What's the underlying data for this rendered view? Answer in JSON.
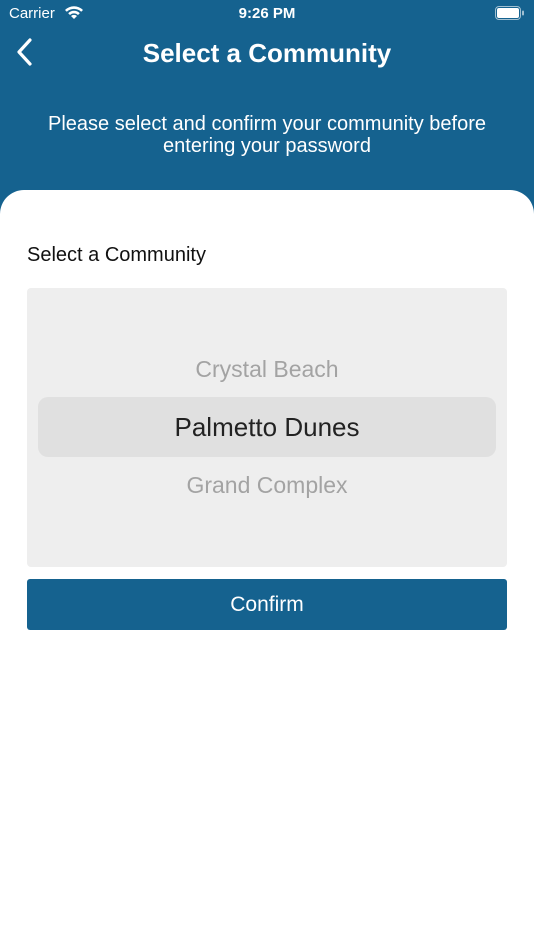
{
  "status_bar": {
    "carrier": "Carrier",
    "time": "9:26 PM",
    "icons": [
      "wifi-icon",
      "battery-icon"
    ]
  },
  "header": {
    "back_icon": "chevron-left-icon",
    "title": "Select a Community",
    "subtitle": "Please select and confirm your community before entering your password"
  },
  "form": {
    "label": "Select a Community",
    "picker": {
      "options_visible": [
        "Crystal Beach",
        "Palmetto Dunes",
        "Grand Complex"
      ],
      "selected": "Palmetto Dunes"
    },
    "confirm_label": "Confirm"
  },
  "colors": {
    "brand": "#15628f",
    "sheet": "#ffffff",
    "picker_bg": "#eeeeee",
    "picker_inactive_text": "#a3a3a3"
  }
}
